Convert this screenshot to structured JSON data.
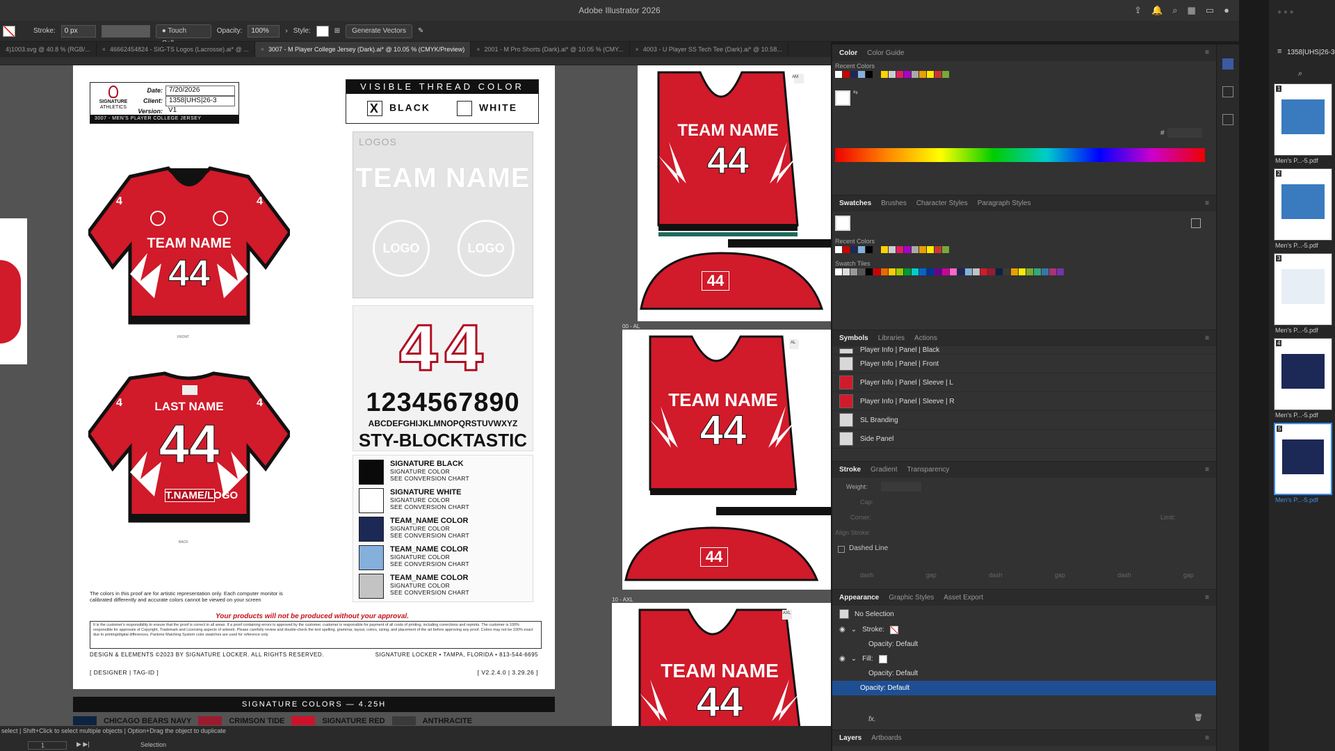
{
  "app": {
    "title": "Adobe Illustrator 2026"
  },
  "control": {
    "stroke_label": "Stroke:",
    "stroke_value": "0 px",
    "brush": "Touch Call...",
    "opacity_label": "Opacity:",
    "opacity_value": "100%",
    "style_label": "Style:",
    "generate_vectors": "Generate Vectors"
  },
  "tabs": [
    {
      "label": "4)1003.svg @ 40.8 % (RGB/..."
    },
    {
      "label": "46662454824 - SIG-TS Logos (Lacrosse).ai* @ ..."
    },
    {
      "label": "3007 - M Player College Jersey (Dark).ai* @ 10.05 % (CMYK/Preview)"
    },
    {
      "label": "2001 - M Pro Shorts (Dark).ai* @ 10.05 % (CMY..."
    },
    {
      "label": "4003 - U Player SS Tech Tee (Dark).ai* @ 10.58..."
    }
  ],
  "proof": {
    "brand": "SIGNATURE",
    "brand_sub": "ATHLETICS",
    "date_label": "Date:",
    "date": "7/20/2026",
    "client_label": "Client:",
    "client": "1358|UHS|26-3",
    "version_label": "Version:",
    "version": "V1",
    "product": "3007 - MEN'S PLAYER COLLEGE JERSEY",
    "thread_title": "VISIBLE THREAD COLOR",
    "thread_black": "BLACK",
    "thread_white": "WHITE",
    "thread_mark": "X",
    "logos_label": "LOGOS",
    "team_name": "TEAM NAME",
    "logo": "LOGO",
    "number": "44",
    "digits": "1234567890",
    "alphabet": "ABCDEFGHIJKLMNOPQRSTUVWXYZ",
    "font_name": "STY-BLOCKTASTIC",
    "colors": [
      {
        "name": "SIGNATURE BLACK",
        "line1": "SIGNATURE COLOR",
        "line2": "SEE CONVERSION CHART",
        "hex": "#0a0a0a"
      },
      {
        "name": "SIGNATURE WHITE",
        "line1": "SIGNATURE COLOR",
        "line2": "SEE CONVERSION CHART",
        "hex": "#ffffff"
      },
      {
        "name": "TEAM_NAME COLOR",
        "line1": "SIGNATURE COLOR",
        "line2": "SEE CONVERSION CHART",
        "hex": "#1c2856"
      },
      {
        "name": "TEAM_NAME COLOR",
        "line1": "SIGNATURE COLOR",
        "line2": "SEE CONVERSION CHART",
        "hex": "#85b0dc"
      },
      {
        "name": "TEAM_NAME COLOR",
        "line1": "SIGNATURE COLOR",
        "line2": "SEE CONVERSION CHART",
        "hex": "#c3c3c3"
      }
    ],
    "front_label": "FRONT",
    "back_label": "BACK",
    "jersey_team": "TEAM NAME",
    "jersey_last": "LAST NAME",
    "jersey_tname": "T.NAME/LOGO",
    "jersey_number": "44",
    "jersey_sleeve": "4",
    "disclaimer": "The colors in this proof are for artistic representation only. Each computer monitor is calibrated differently and accurate colors cannot be viewed on your screen",
    "warning": "Your products will not be produced without your approval.",
    "legal": "It is the customer's responsibility to ensure that the proof is correct in all areas. If a proof containing errors is approved by the customer, customer is responsible for payment of all costs of printing, including corrections and reprints. The customer is 100% responsible for approvals of Copyright, Trademark and Licensing aspects of artwork. Please carefully review and double-check the text spelling, grammar, layout, colors, sizing, and placement of the art before approving any proof. Colors may not be 100% exact due to printing/digital differences. Pantone Matching System color swatches are used for reference only.",
    "copyright": "DESIGN & ELEMENTS ©2023 BY SIGNATURE LOCKER. ALL RIGHTS RESERVED.",
    "address": "SIGNATURE LOCKER • TAMPA, FLORIDA • 813-544-6695",
    "designer_tag": "[ DESIGNER | TAG-ID ]",
    "version_tag": "[ V2.2.4.0 | 3.29.26 ]",
    "sig_colors_title": "SIGNATURE COLORS — 4.25H",
    "sig_colors": [
      {
        "name": "CHICAGO BEARS NAVY",
        "hex": "#0c2440"
      },
      {
        "name": "CRIMSON TIDE",
        "hex": "#9a1b30"
      },
      {
        "name": "SIGNATURE RED",
        "hex": "#d0112b"
      },
      {
        "name": "ANTHRACITE",
        "hex": "#3a3a3a"
      }
    ]
  },
  "artboards": {
    "label_1": "00 - AL",
    "label_2": "10 - AXL",
    "tag_1": "AM",
    "tag_2": "AL",
    "tag_3": "AXL"
  },
  "status": {
    "hint": "select  |  Shift+Click to select multiple objects  |  Option+Drag the object to duplicate",
    "page": "1",
    "tool": "Selection"
  },
  "color_panel": {
    "tab1": "Color",
    "tab2": "Color Guide",
    "recent": "Recent Colors",
    "hash": "#"
  },
  "swatches_panel": {
    "tabs": [
      "Swatches",
      "Brushes",
      "Character Styles",
      "Paragraph Styles"
    ],
    "recent": "Recent Colors",
    "tiles": "Swatch Tiles"
  },
  "symbols_panel": {
    "tabs": [
      "Symbols",
      "Libraries",
      "Actions"
    ],
    "items": [
      "Player Info | Panel | Black",
      "Player Info | Panel | Front",
      "Player Info | Panel | Sleeve | L",
      "Player Info | Panel | Sleeve | R",
      "SL Branding",
      "Side Panel"
    ]
  },
  "stroke_panel": {
    "tabs": [
      "Stroke",
      "Gradient",
      "Transparency"
    ],
    "weight": "Weight:",
    "cap": "Cap:",
    "corner": "Corner:",
    "align": "Align Stroke:",
    "limit": "Limit:",
    "dashed": "Dashed Line",
    "dash_labels": [
      "dash",
      "gap",
      "dash",
      "gap",
      "dash",
      "gap"
    ]
  },
  "appearance_panel": {
    "tabs": [
      "Appearance",
      "Graphic Styles",
      "Asset Export"
    ],
    "no_selection": "No Selection",
    "stroke": "Stroke:",
    "fill": "Fill:",
    "opacity1": "Opacity: Default",
    "opacity2": "Opacity: Default",
    "opacity3": "Opacity: Default",
    "fx": "fx."
  },
  "layers_panel": {
    "tabs": [
      "Layers",
      "Artboards"
    ]
  },
  "pages_sidebar": {
    "title": "1358|UHS|26-3",
    "items": [
      {
        "n": "1",
        "name": "Men's P...-5.pdf"
      },
      {
        "n": "2",
        "name": "Men's P...-5.pdf"
      },
      {
        "n": "3",
        "name": "Men's P...-5.pdf"
      },
      {
        "n": "4",
        "name": "Men's P...-5.pdf"
      },
      {
        "n": "5",
        "name": "Men's P...-5.pdf"
      }
    ]
  },
  "colors": {
    "jersey_red": "#d11a2a",
    "accent_blue": "#1f4f93"
  }
}
